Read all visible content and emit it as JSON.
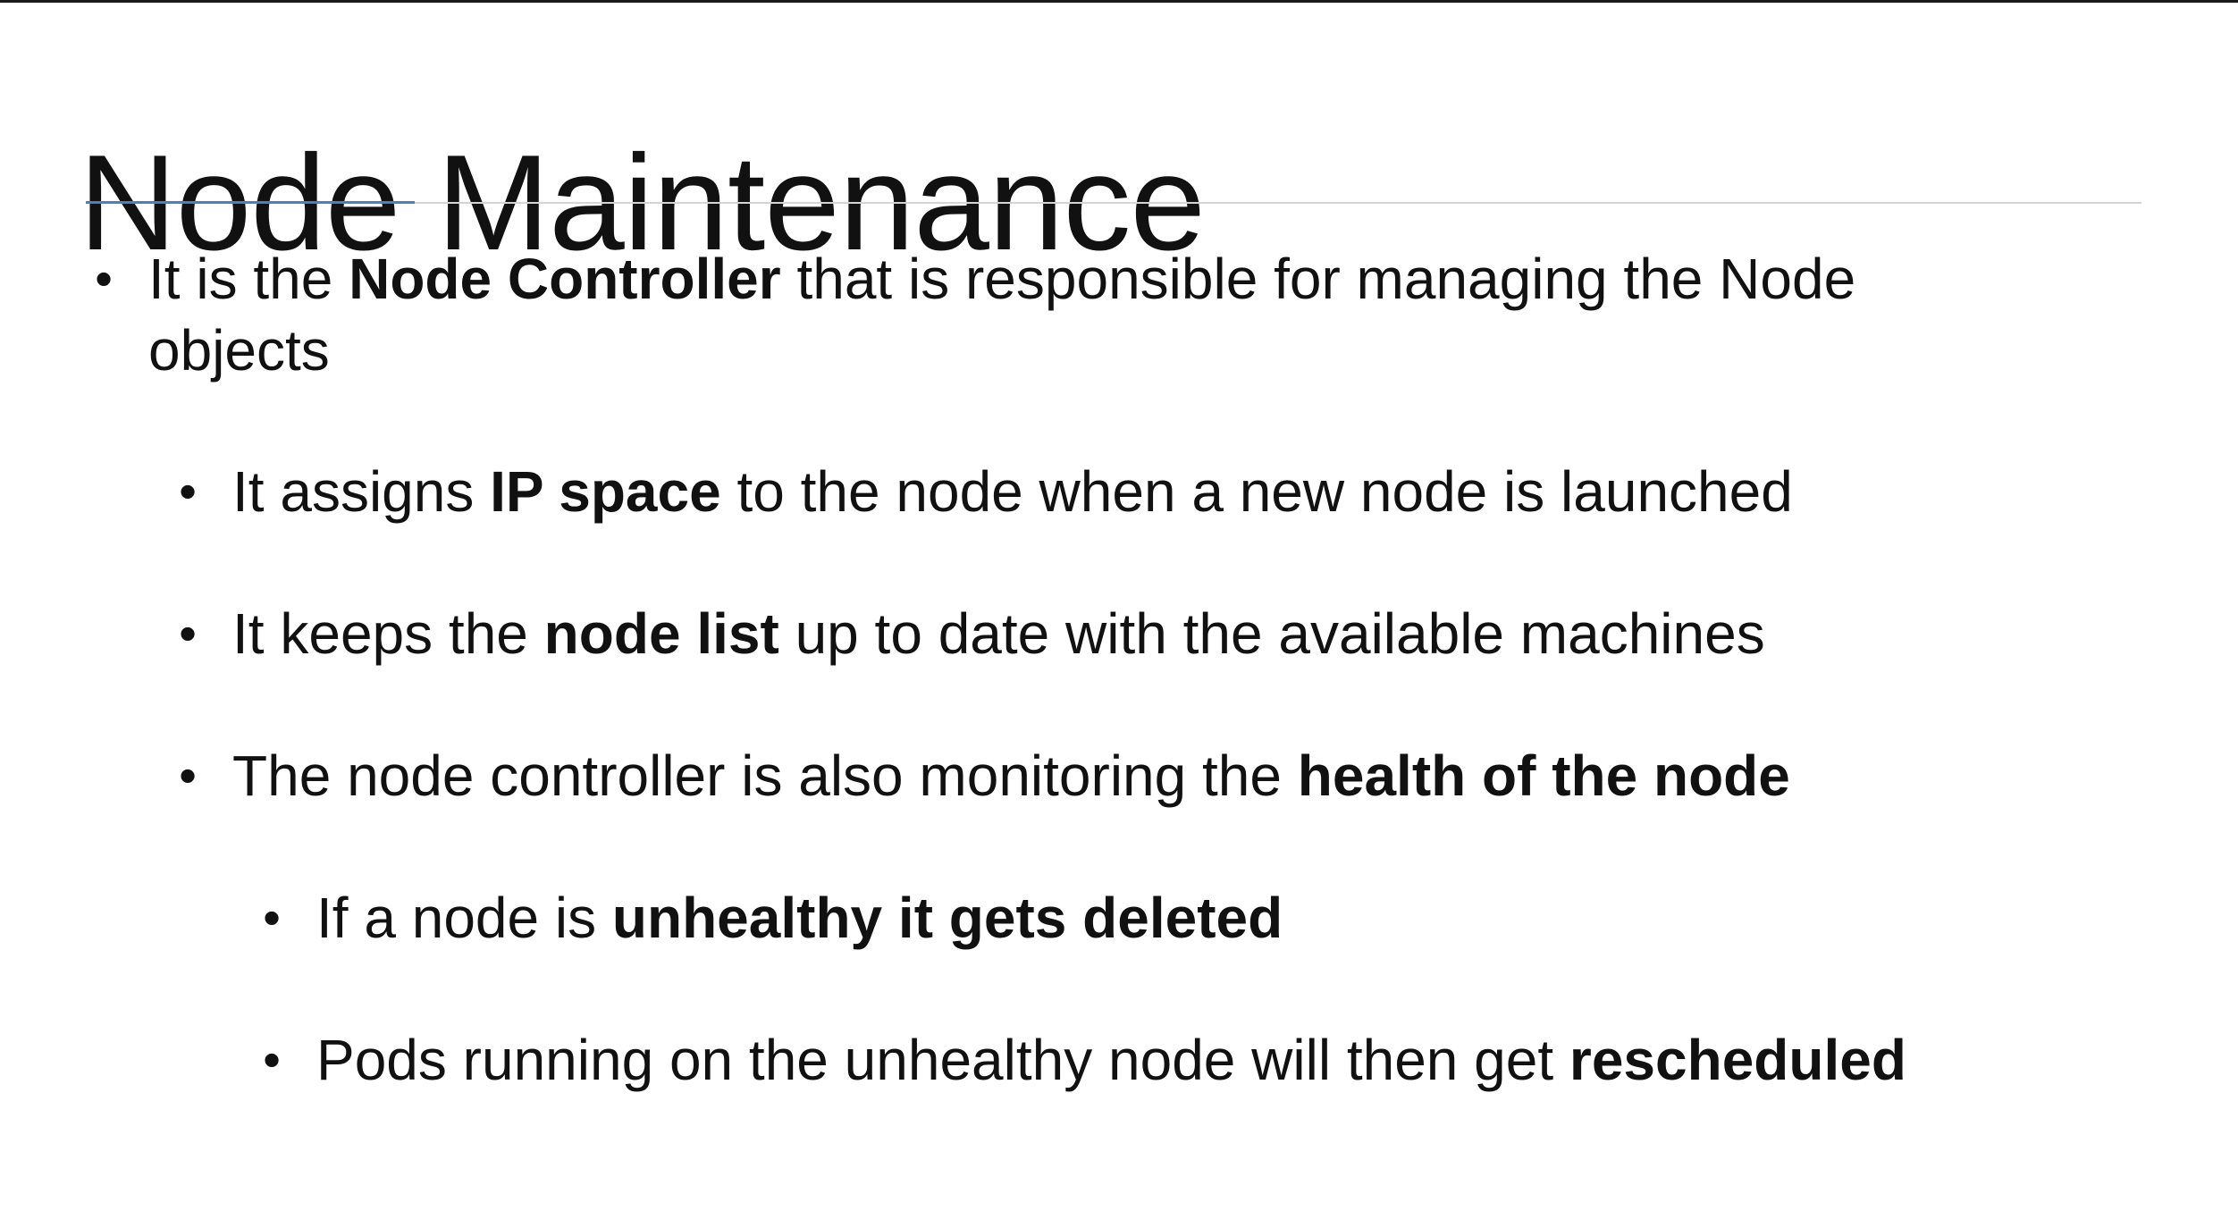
{
  "slide": {
    "title": "Node Maintenance",
    "colors": {
      "text": "#111111",
      "rule": "#d4d4d4",
      "accent": "#4a7fc0",
      "background": "#ffffff"
    },
    "bullets": [
      {
        "level": 1,
        "pre": "It is the ",
        "bold": "Node Controller",
        "post": " that is responsible for managing the Node",
        "line2": "objects"
      },
      {
        "level": 2,
        "pre": "It assigns ",
        "bold": "IP space",
        "post": " to the node when a new node is launched"
      },
      {
        "level": 2,
        "pre": "It keeps the ",
        "bold": "node list",
        "post": " up to date with the available machines"
      },
      {
        "level": 2,
        "pre": "The node controller is also monitoring the ",
        "bold": "health of the node",
        "post": ""
      },
      {
        "level": 3,
        "pre": "If a node is ",
        "bold": "unhealthy it gets deleted",
        "post": ""
      },
      {
        "level": 3,
        "pre": "Pods running on the unhealthy node will then get ",
        "bold": "rescheduled",
        "post": ""
      }
    ]
  }
}
